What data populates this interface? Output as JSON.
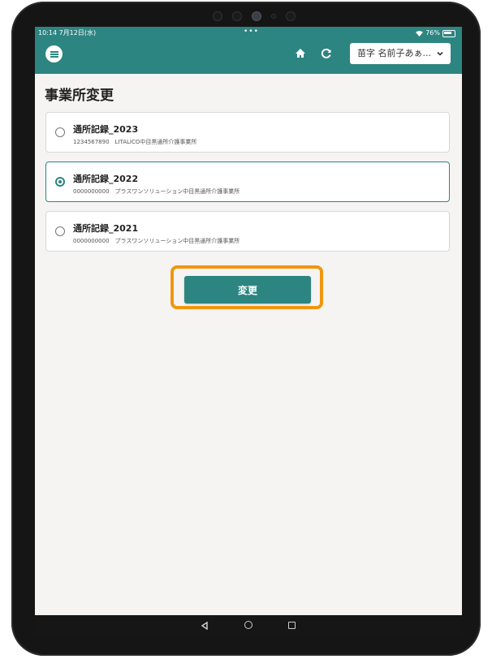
{
  "status_bar": {
    "time": "10:14  7月12日(水)",
    "dots": "•••",
    "battery": "76%"
  },
  "header": {
    "menu_icon": "hamburger-icon",
    "home_icon": "home-icon",
    "refresh_icon": "refresh-icon",
    "user_select": "苗字 名前子あぁ...",
    "chevron_icon": "chevron-down-icon"
  },
  "page": {
    "title": "事業所変更"
  },
  "offices": [
    {
      "title": "通所記録_2023",
      "subtitle": "1234567890　LITALICO中目黒通所介護事業所",
      "selected": false
    },
    {
      "title": "通所記録_2022",
      "subtitle": "0000000000　プラスワンソリューション中目黒通所介護事業所",
      "selected": true
    },
    {
      "title": "通所記録_2021",
      "subtitle": "0000000000　プラスワンソリューション中目黒通所介護事業所",
      "selected": false
    }
  ],
  "actions": {
    "submit_label": "変更"
  },
  "colors": {
    "header": "#2c8581",
    "highlight": "#f0960e",
    "background": "#f6f4f2"
  }
}
